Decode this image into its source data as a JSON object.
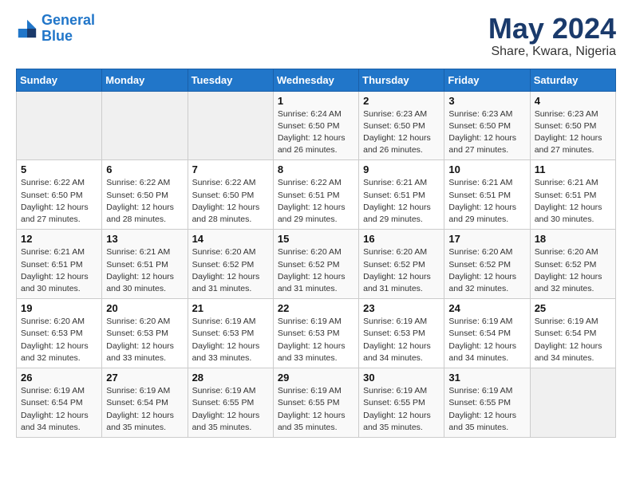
{
  "header": {
    "logo_line1": "General",
    "logo_line2": "Blue",
    "title": "May 2024",
    "subtitle": "Share, Kwara, Nigeria"
  },
  "calendar": {
    "weekdays": [
      "Sunday",
      "Monday",
      "Tuesday",
      "Wednesday",
      "Thursday",
      "Friday",
      "Saturday"
    ],
    "weeks": [
      [
        {
          "day": "",
          "info": ""
        },
        {
          "day": "",
          "info": ""
        },
        {
          "day": "",
          "info": ""
        },
        {
          "day": "1",
          "info": "Sunrise: 6:24 AM\nSunset: 6:50 PM\nDaylight: 12 hours\nand 26 minutes."
        },
        {
          "day": "2",
          "info": "Sunrise: 6:23 AM\nSunset: 6:50 PM\nDaylight: 12 hours\nand 26 minutes."
        },
        {
          "day": "3",
          "info": "Sunrise: 6:23 AM\nSunset: 6:50 PM\nDaylight: 12 hours\nand 27 minutes."
        },
        {
          "day": "4",
          "info": "Sunrise: 6:23 AM\nSunset: 6:50 PM\nDaylight: 12 hours\nand 27 minutes."
        }
      ],
      [
        {
          "day": "5",
          "info": "Sunrise: 6:22 AM\nSunset: 6:50 PM\nDaylight: 12 hours\nand 27 minutes."
        },
        {
          "day": "6",
          "info": "Sunrise: 6:22 AM\nSunset: 6:50 PM\nDaylight: 12 hours\nand 28 minutes."
        },
        {
          "day": "7",
          "info": "Sunrise: 6:22 AM\nSunset: 6:50 PM\nDaylight: 12 hours\nand 28 minutes."
        },
        {
          "day": "8",
          "info": "Sunrise: 6:22 AM\nSunset: 6:51 PM\nDaylight: 12 hours\nand 29 minutes."
        },
        {
          "day": "9",
          "info": "Sunrise: 6:21 AM\nSunset: 6:51 PM\nDaylight: 12 hours\nand 29 minutes."
        },
        {
          "day": "10",
          "info": "Sunrise: 6:21 AM\nSunset: 6:51 PM\nDaylight: 12 hours\nand 29 minutes."
        },
        {
          "day": "11",
          "info": "Sunrise: 6:21 AM\nSunset: 6:51 PM\nDaylight: 12 hours\nand 30 minutes."
        }
      ],
      [
        {
          "day": "12",
          "info": "Sunrise: 6:21 AM\nSunset: 6:51 PM\nDaylight: 12 hours\nand 30 minutes."
        },
        {
          "day": "13",
          "info": "Sunrise: 6:21 AM\nSunset: 6:51 PM\nDaylight: 12 hours\nand 30 minutes."
        },
        {
          "day": "14",
          "info": "Sunrise: 6:20 AM\nSunset: 6:52 PM\nDaylight: 12 hours\nand 31 minutes."
        },
        {
          "day": "15",
          "info": "Sunrise: 6:20 AM\nSunset: 6:52 PM\nDaylight: 12 hours\nand 31 minutes."
        },
        {
          "day": "16",
          "info": "Sunrise: 6:20 AM\nSunset: 6:52 PM\nDaylight: 12 hours\nand 31 minutes."
        },
        {
          "day": "17",
          "info": "Sunrise: 6:20 AM\nSunset: 6:52 PM\nDaylight: 12 hours\nand 32 minutes."
        },
        {
          "day": "18",
          "info": "Sunrise: 6:20 AM\nSunset: 6:52 PM\nDaylight: 12 hours\nand 32 minutes."
        }
      ],
      [
        {
          "day": "19",
          "info": "Sunrise: 6:20 AM\nSunset: 6:53 PM\nDaylight: 12 hours\nand 32 minutes."
        },
        {
          "day": "20",
          "info": "Sunrise: 6:20 AM\nSunset: 6:53 PM\nDaylight: 12 hours\nand 33 minutes."
        },
        {
          "day": "21",
          "info": "Sunrise: 6:19 AM\nSunset: 6:53 PM\nDaylight: 12 hours\nand 33 minutes."
        },
        {
          "day": "22",
          "info": "Sunrise: 6:19 AM\nSunset: 6:53 PM\nDaylight: 12 hours\nand 33 minutes."
        },
        {
          "day": "23",
          "info": "Sunrise: 6:19 AM\nSunset: 6:53 PM\nDaylight: 12 hours\nand 34 minutes."
        },
        {
          "day": "24",
          "info": "Sunrise: 6:19 AM\nSunset: 6:54 PM\nDaylight: 12 hours\nand 34 minutes."
        },
        {
          "day": "25",
          "info": "Sunrise: 6:19 AM\nSunset: 6:54 PM\nDaylight: 12 hours\nand 34 minutes."
        }
      ],
      [
        {
          "day": "26",
          "info": "Sunrise: 6:19 AM\nSunset: 6:54 PM\nDaylight: 12 hours\nand 34 minutes."
        },
        {
          "day": "27",
          "info": "Sunrise: 6:19 AM\nSunset: 6:54 PM\nDaylight: 12 hours\nand 35 minutes."
        },
        {
          "day": "28",
          "info": "Sunrise: 6:19 AM\nSunset: 6:55 PM\nDaylight: 12 hours\nand 35 minutes."
        },
        {
          "day": "29",
          "info": "Sunrise: 6:19 AM\nSunset: 6:55 PM\nDaylight: 12 hours\nand 35 minutes."
        },
        {
          "day": "30",
          "info": "Sunrise: 6:19 AM\nSunset: 6:55 PM\nDaylight: 12 hours\nand 35 minutes."
        },
        {
          "day": "31",
          "info": "Sunrise: 6:19 AM\nSunset: 6:55 PM\nDaylight: 12 hours\nand 35 minutes."
        },
        {
          "day": "",
          "info": ""
        }
      ]
    ]
  }
}
